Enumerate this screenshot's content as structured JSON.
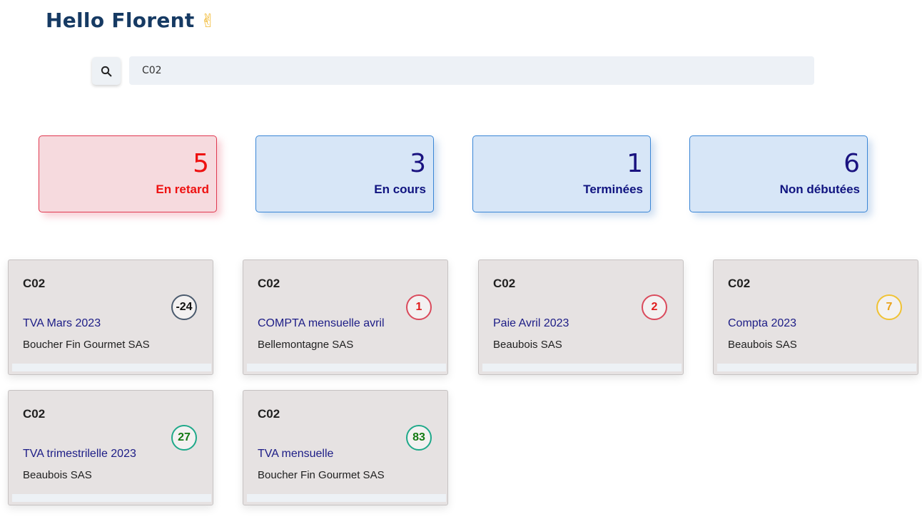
{
  "header": {
    "greeting": "Hello Florent",
    "emoji": "✌"
  },
  "search": {
    "value": "C02",
    "icon": "search-icon"
  },
  "stats": [
    {
      "value": "5",
      "label": "En retard",
      "color": "#ee1111"
    },
    {
      "value": "3",
      "label": "En cours",
      "color": "#101480"
    },
    {
      "value": "1",
      "label": "Terminées",
      "color": "#101480"
    },
    {
      "value": "6",
      "label": "Non débutées",
      "color": "#101480"
    }
  ],
  "cards": [
    {
      "code": "C02",
      "title": "TVA Mars 2023",
      "client": "Boucher Fin Gourmet SAS",
      "badge": "-24",
      "badge_color": "#4b5b6e"
    },
    {
      "code": "C02",
      "title": "COMPTA mensuelle avril",
      "client": "Bellemontagne SAS",
      "badge": "1",
      "badge_color": "#da4a5c"
    },
    {
      "code": "C02",
      "title": "Paie Avril 2023",
      "client": "Beaubois SAS",
      "badge": "2",
      "badge_color": "#da4a5c"
    },
    {
      "code": "C02",
      "title": "Compta 2023",
      "client": "Beaubois SAS",
      "badge": "7",
      "badge_color": "#f0c233"
    },
    {
      "code": "C02",
      "title": "TVA trimestrilelle 2023",
      "client": "Beaubois SAS",
      "badge": "27",
      "badge_color": "#1fa98a"
    },
    {
      "code": "C02",
      "title": "TVA mensuelle",
      "client": "Boucher Fin Gourmet SAS",
      "badge": "83",
      "badge_color": "#1fa98a"
    }
  ]
}
